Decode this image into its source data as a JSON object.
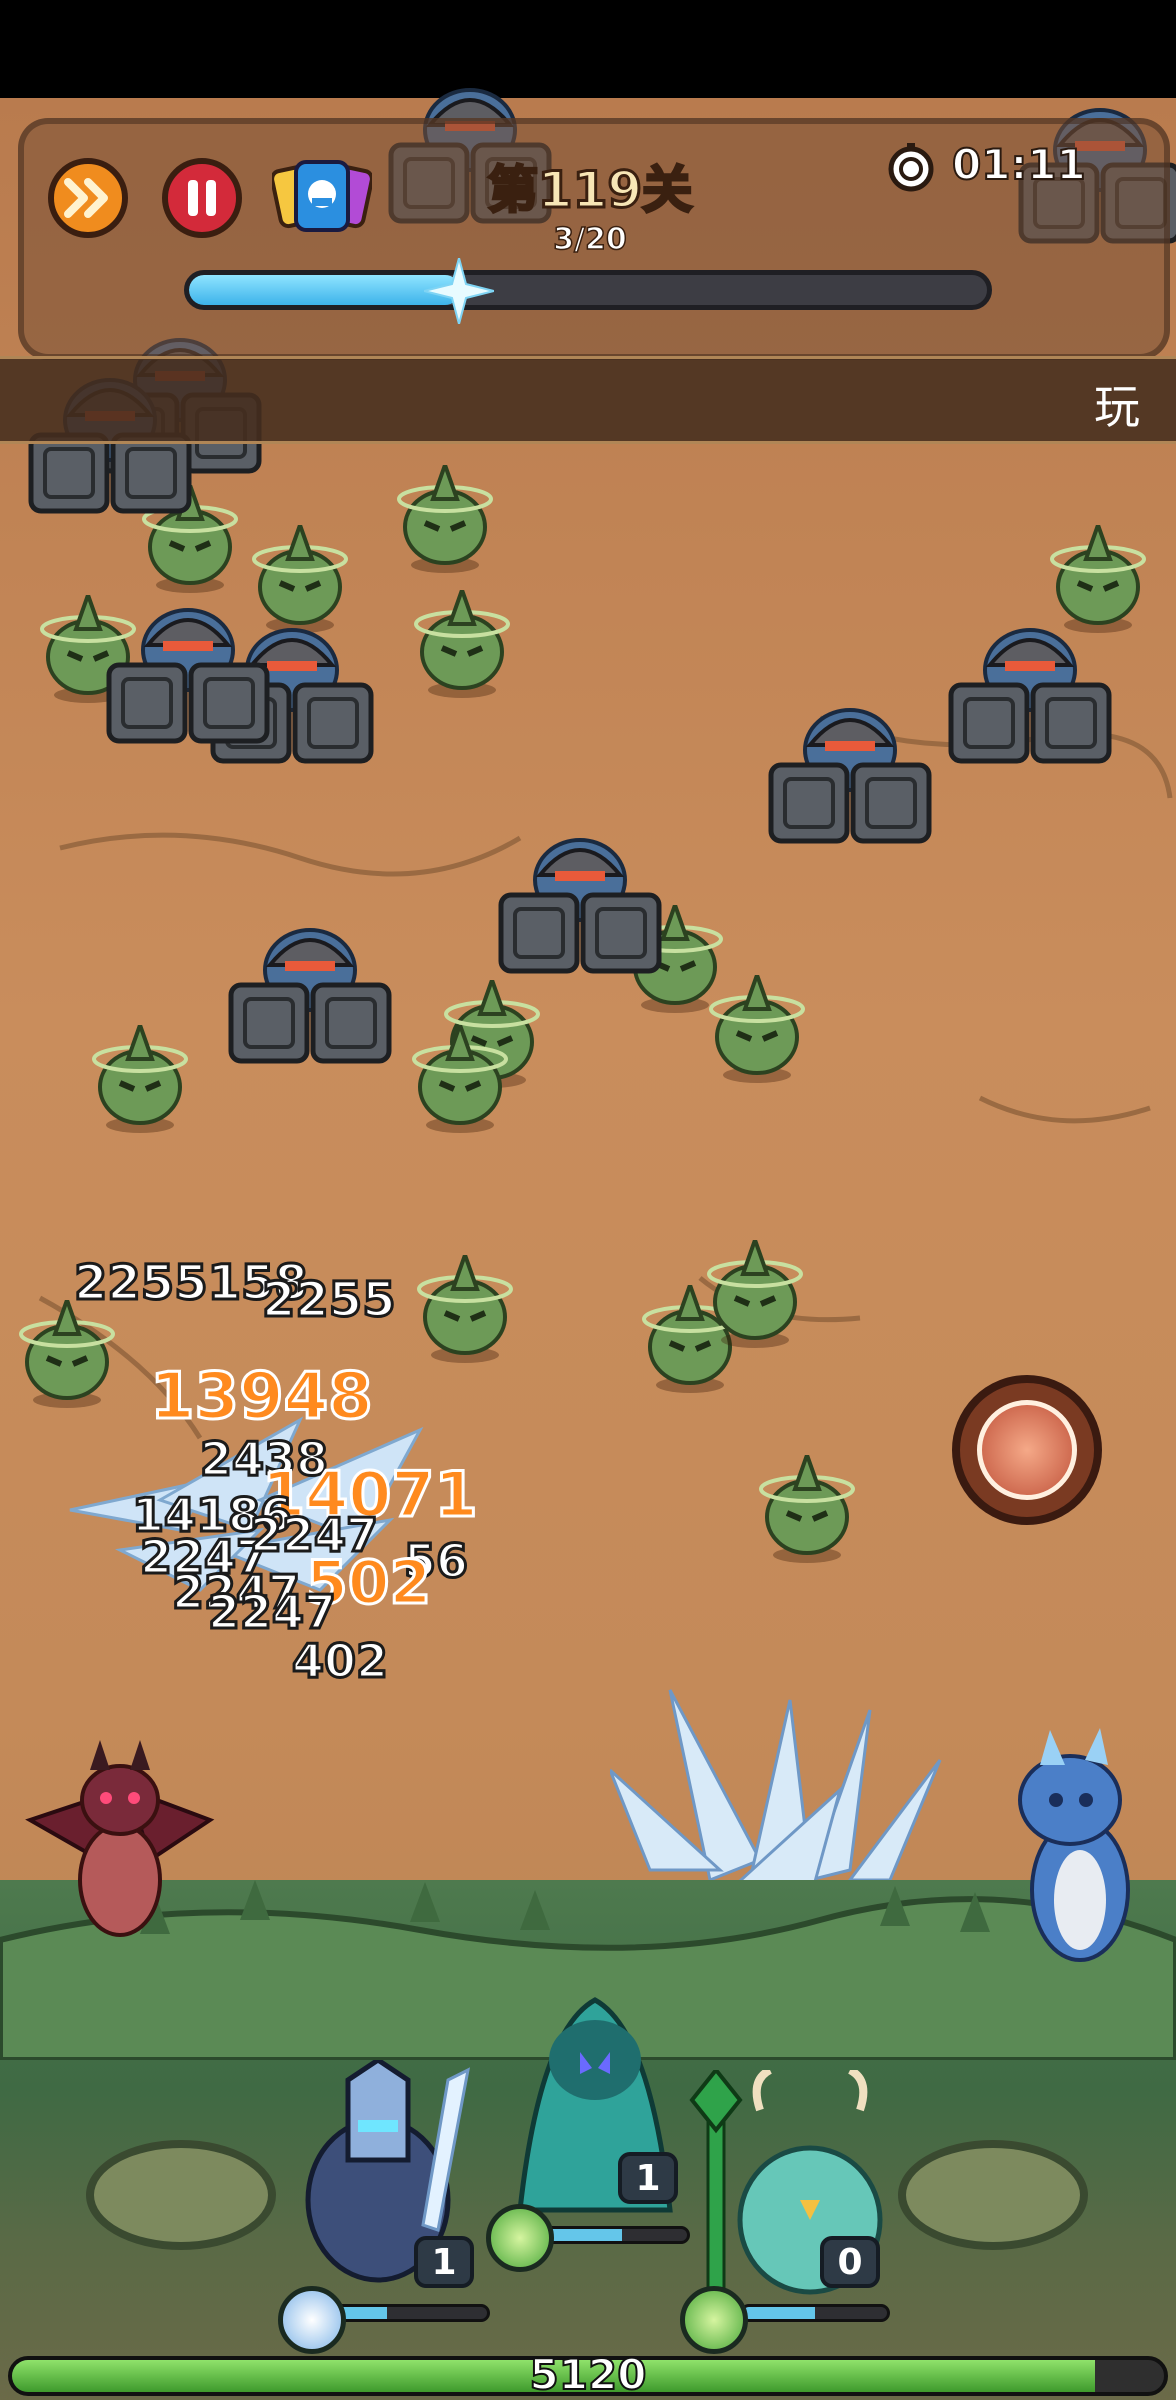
{
  "hud": {
    "stage_title": "第119关",
    "wave_progress_text": "3/20",
    "wave_progress_fraction": 0.34,
    "timer": "01:11",
    "fast_forward_icon": "double-chevron-right-icon",
    "pause_icon": "pause-icon",
    "card_icon": "hero-card-icon",
    "timer_icon": "stopwatch-icon"
  },
  "banner": {
    "text": "玩"
  },
  "damage_numbers": [
    "2255158",
    "2255",
    "13948",
    "2438",
    "14071",
    "14186",
    "2247",
    "2247",
    "2247",
    "56",
    "502",
    "2247",
    "402"
  ],
  "heroes": [
    {
      "name": "ice-knight",
      "level": "1",
      "mana_fraction": 0.35,
      "orb_icon": "ice-crystal-icon"
    },
    {
      "name": "jade-mage",
      "level": "1",
      "mana_fraction": 0.55,
      "orb_icon": "wind-swirl-icon"
    },
    {
      "name": "forest-owl",
      "level": "0",
      "mana_fraction": 0.5,
      "orb_icon": "wind-swirl-icon"
    }
  ],
  "skill_button_icon": "shield-shatter-icon",
  "base_hp": {
    "value": "5120",
    "fraction": 0.94
  },
  "colors": {
    "accent_blue": "#64c6ea",
    "hp_green": "#3e9a2c",
    "fast_forward_orange": "#f08c1e",
    "pause_red": "#d32a3a"
  }
}
